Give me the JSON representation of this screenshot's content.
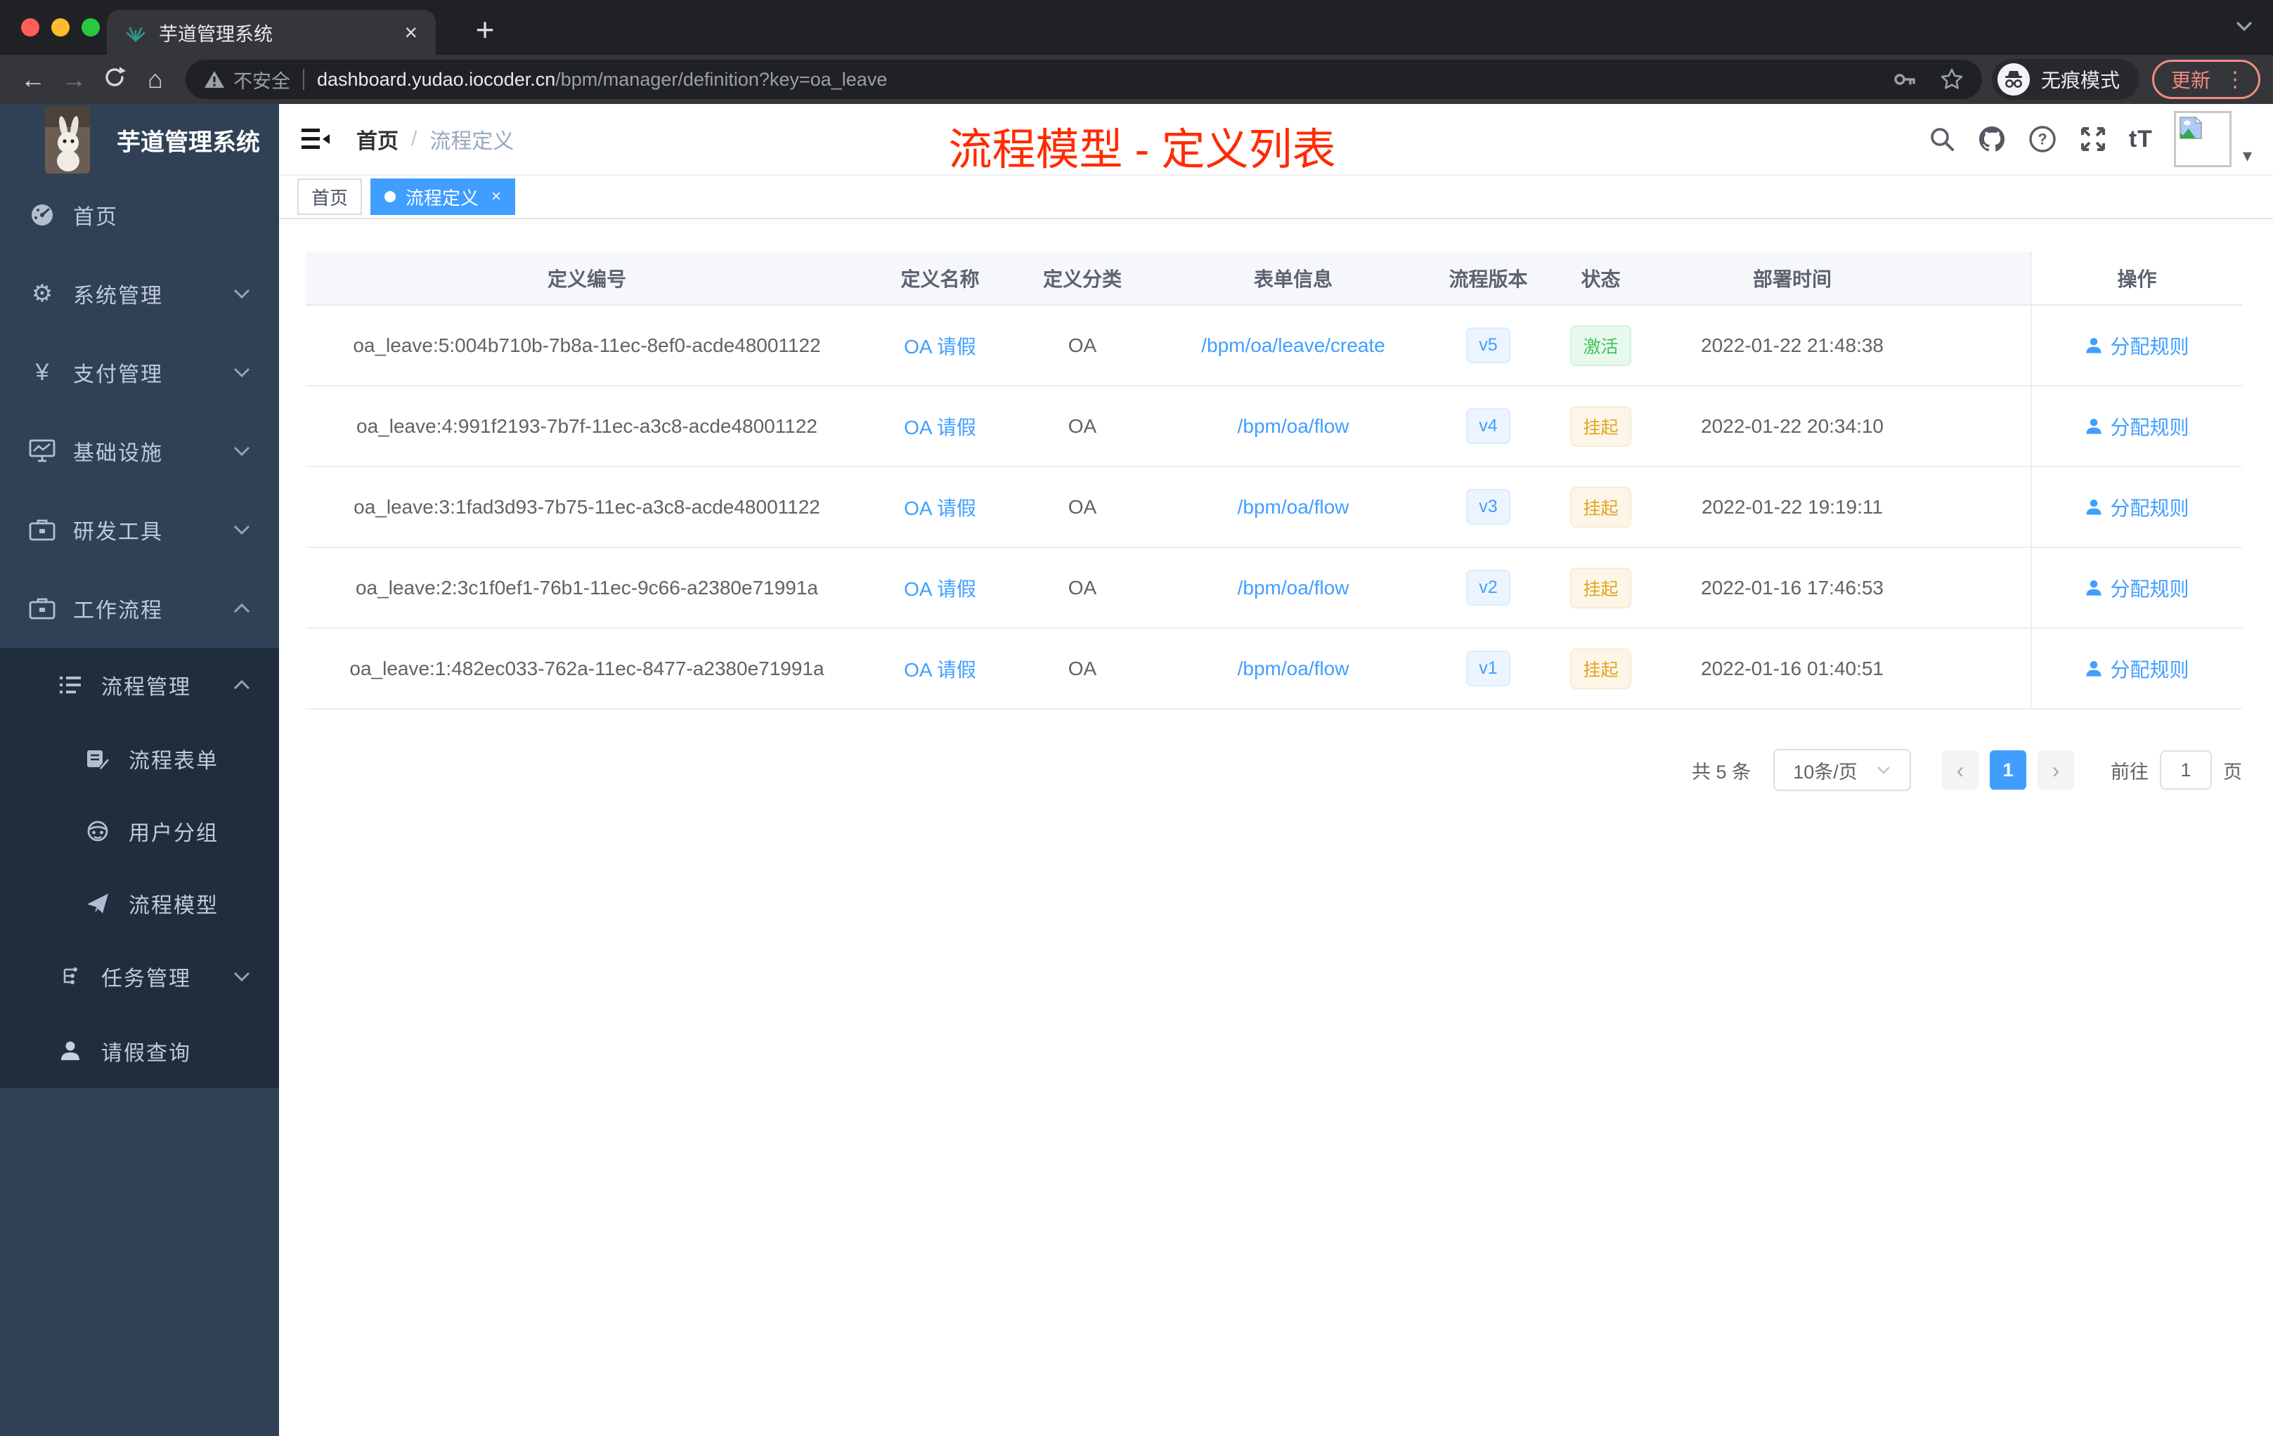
{
  "browser": {
    "tab_title": "芋道管理系统",
    "security_label": "不安全",
    "url_host": "dashboard.yudao.iocoder.cn",
    "url_path": "/bpm/manager/definition?key=oa_leave",
    "incognito_label": "无痕模式",
    "update_label": "更新"
  },
  "icons": {
    "back": "←",
    "forward": "→",
    "home": "⌂",
    "plus": "+",
    "close": "×",
    "dots_v": "⋮",
    "caret_down": "▾",
    "prev": "‹",
    "next": "›",
    "gear": "⚙",
    "yuan": "¥",
    "text_size": "tT",
    "question": "?"
  },
  "sidebar": {
    "app_title": "芋道管理系统",
    "items": [
      {
        "label": "首页"
      },
      {
        "label": "系统管理"
      },
      {
        "label": "支付管理"
      },
      {
        "label": "基础设施"
      },
      {
        "label": "研发工具"
      },
      {
        "label": "工作流程"
      },
      {
        "label": "流程管理"
      },
      {
        "label": "流程表单"
      },
      {
        "label": "用户分组"
      },
      {
        "label": "流程模型"
      },
      {
        "label": "任务管理"
      },
      {
        "label": "请假查询"
      }
    ]
  },
  "header": {
    "breadcrumb_home": "首页",
    "breadcrumb_sep": "/",
    "breadcrumb_current": "流程定义",
    "annotation": "流程模型 - 定义列表",
    "annotation_color": "#ff2b00"
  },
  "tags": [
    {
      "label": "首页",
      "active": false
    },
    {
      "label": "流程定义",
      "active": true
    }
  ],
  "table": {
    "columns": [
      "定义编号",
      "定义名称",
      "定义分类",
      "表单信息",
      "流程版本",
      "状态",
      "部署时间",
      "操作"
    ],
    "rows": [
      {
        "id": "oa_leave:5:004b710b-7b8a-11ec-8ef0-acde48001122",
        "name": "OA 请假",
        "category": "OA",
        "form": "/bpm/oa/leave/create",
        "version": "v5",
        "status": "激活",
        "status_type": "success",
        "time": "2022-01-22 21:48:38",
        "action": "分配规则"
      },
      {
        "id": "oa_leave:4:991f2193-7b7f-11ec-a3c8-acde48001122",
        "name": "OA 请假",
        "category": "OA",
        "form": "/bpm/oa/flow",
        "version": "v4",
        "status": "挂起",
        "status_type": "warning",
        "time": "2022-01-22 20:34:10",
        "action": "分配规则"
      },
      {
        "id": "oa_leave:3:1fad3d93-7b75-11ec-a3c8-acde48001122",
        "name": "OA 请假",
        "category": "OA",
        "form": "/bpm/oa/flow",
        "version": "v3",
        "status": "挂起",
        "status_type": "warning",
        "time": "2022-01-22 19:19:11",
        "action": "分配规则"
      },
      {
        "id": "oa_leave:2:3c1f0ef1-76b1-11ec-9c66-a2380e71991a",
        "name": "OA 请假",
        "category": "OA",
        "form": "/bpm/oa/flow",
        "version": "v2",
        "status": "挂起",
        "status_type": "warning",
        "time": "2022-01-16 17:46:53",
        "action": "分配规则"
      },
      {
        "id": "oa_leave:1:482ec033-762a-11ec-8477-a2380e71991a",
        "name": "OA 请假",
        "category": "OA",
        "form": "/bpm/oa/flow",
        "version": "v1",
        "status": "挂起",
        "status_type": "warning",
        "time": "2022-01-16 01:40:51",
        "action": "分配规则"
      }
    ]
  },
  "pagination": {
    "total_label": "共 5 条",
    "page_size": "10条/页",
    "current_page": "1",
    "goto_label": "前往",
    "goto_value": "1",
    "page_unit": "页"
  },
  "colors": {
    "accent": "#409eff",
    "sidebar_bg": "#304156",
    "submenu_bg": "#1f2d3d",
    "success": "#43c161",
    "warning": "#e3a41f",
    "annotation_red": "#ff2b00"
  }
}
